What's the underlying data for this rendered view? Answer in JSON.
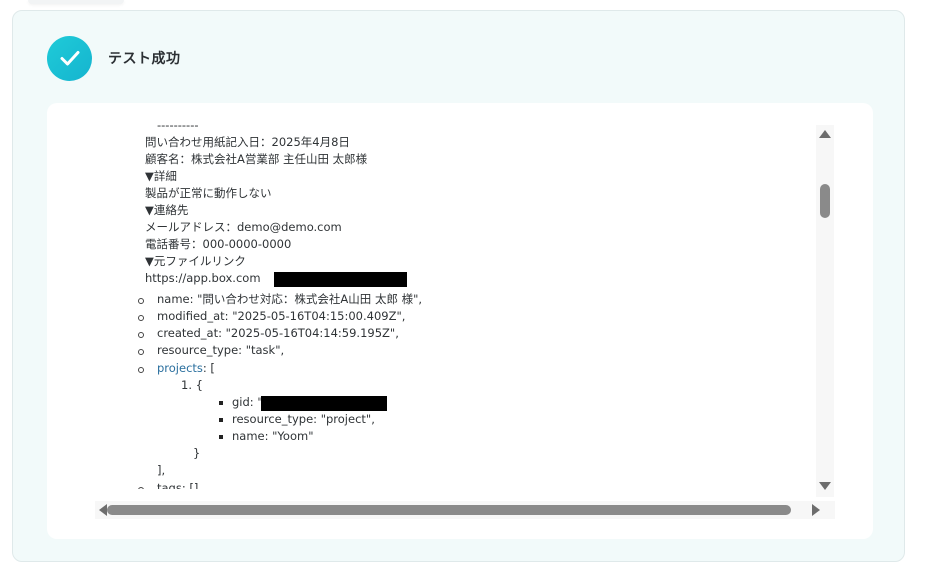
{
  "header": {
    "title": "テスト成功",
    "icon": "check-icon",
    "accent_color": "#1fc0d6"
  },
  "output": {
    "lines": {
      "separator": "----------",
      "inquiry_date": "問い合わせ用紙記入日：2025年4月8日",
      "customer": "顧客名：株式会社A営業部 主任山田 太郎様",
      "details_heading": "▼詳細",
      "details_text": "製品が正常に動作しない",
      "contact_heading": "▼連絡先",
      "email": "メールアドレス：demo@demo.com",
      "phone": "電話番号：000-0000-0000",
      "file_link_heading": "▼元ファイルリンク",
      "file_link_url": "https://app.box.com",
      "name_field": "name: \"問い合わせ対応：株式会社A山田 太郎 様\",",
      "modified_at": "modified_at: \"2025-05-16T04:15:00.409Z\",",
      "created_at": "created_at: \"2025-05-16T04:14:59.195Z\",",
      "resource_type": "resource_type: \"task\",",
      "projects_key": "projects",
      "projects_open": ": [",
      "item_one": "1. {",
      "gid": "gid: \"",
      "project_resource_type": "resource_type: \"project\",",
      "project_name": "name: \"Yoom\"",
      "close_brace": "}",
      "close_bracket": "],",
      "tags": "tags: []"
    }
  }
}
